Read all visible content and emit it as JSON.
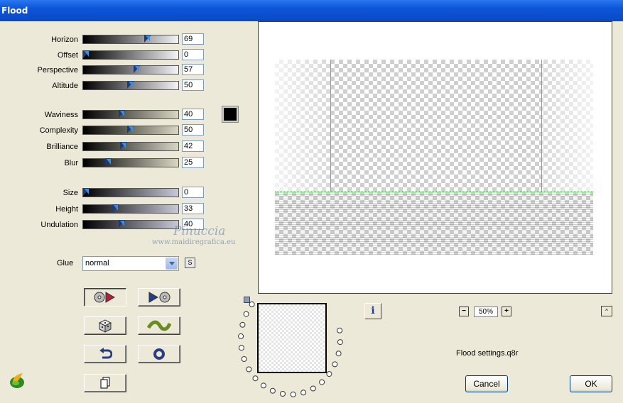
{
  "window": {
    "title": "Flood"
  },
  "sliders": [
    {
      "id": "horizon",
      "label": "Horizon",
      "value": "69",
      "level": 69
    },
    {
      "id": "offset",
      "label": "Offset",
      "value": "0",
      "level": 0
    },
    {
      "id": "perspective",
      "label": "Perspective",
      "value": "57",
      "level": 57
    },
    {
      "id": "altitude",
      "label": "Altitude",
      "value": "50",
      "level": 50
    },
    {
      "id": "waviness",
      "label": "Waviness",
      "value": "40",
      "level": 40
    },
    {
      "id": "complexity",
      "label": "Complexity",
      "value": "50",
      "level": 50
    },
    {
      "id": "brilliance",
      "label": "Brilliance",
      "value": "42",
      "level": 42
    },
    {
      "id": "blur",
      "label": "Blur",
      "value": "25",
      "level": 25
    },
    {
      "id": "size",
      "label": "Size",
      "value": "0",
      "level": 0
    },
    {
      "id": "height",
      "label": "Height",
      "value": "33",
      "level": 33
    },
    {
      "id": "undulation",
      "label": "Undulation",
      "value": "40",
      "level": 40
    }
  ],
  "color_swatch": "#000000",
  "glue": {
    "label": "Glue",
    "selected": "normal",
    "s_button": "S"
  },
  "watermark": {
    "line1": "Pinuccia",
    "line2": "www.maidiregrafica.eu"
  },
  "info_button": "i",
  "zoom": {
    "minus": "−",
    "value": "50%",
    "plus": "+"
  },
  "collapse_button": "^",
  "settings_file": "Flood settings.q8r",
  "buttons": {
    "cancel": "Cancel",
    "ok": "OK"
  },
  "accent": "#0a49c6"
}
